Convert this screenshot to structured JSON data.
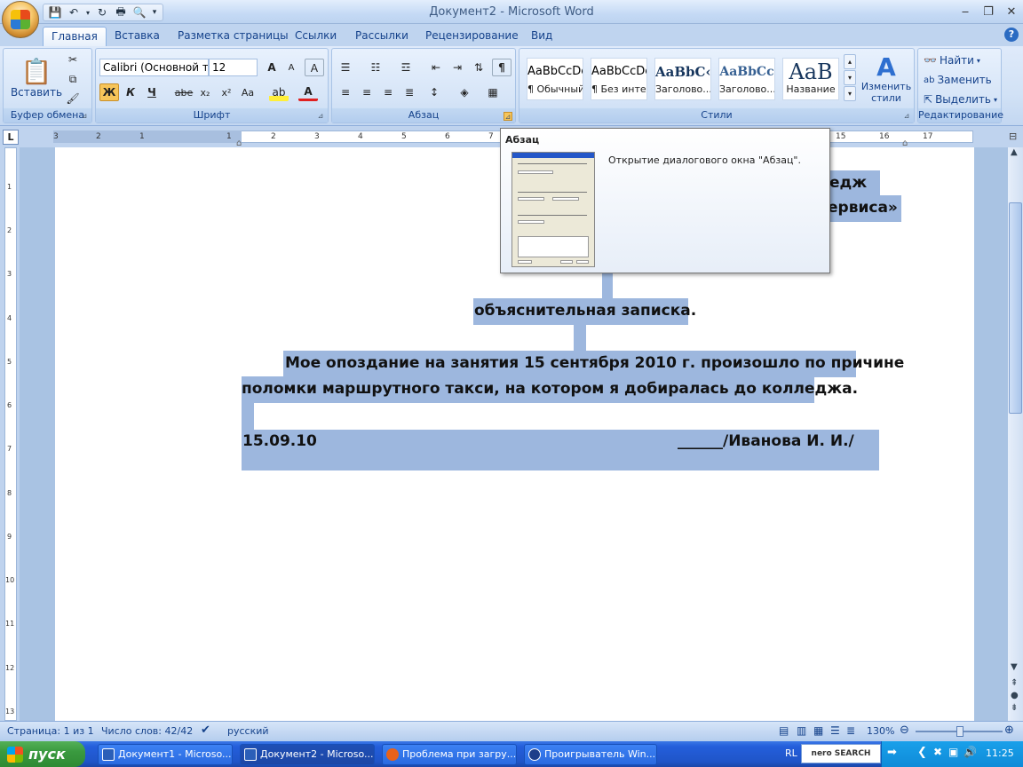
{
  "window": {
    "title": "Документ2 - Microsoft Word",
    "minimize": "‒",
    "restore": "❐",
    "close": "✕"
  },
  "tabs": [
    "Главная",
    "Вставка",
    "Разметка страницы",
    "Ссылки",
    "Рассылки",
    "Рецензирование",
    "Вид"
  ],
  "ribbon": {
    "clipboard": {
      "label": "Буфер обмена",
      "paste": "Вставить"
    },
    "font": {
      "label": "Шрифт",
      "font_name": "Calibri (Основной те",
      "font_size": "12",
      "bold": "Ж",
      "italic": "К",
      "underline": "Ч",
      "strike": "abe",
      "subscript": "x₂",
      "superscript": "x²",
      "change_case": "Аа",
      "grow": "A",
      "shrink": "A",
      "font_color": "A"
    },
    "paragraph": {
      "label": "Абзац",
      "show_marks": "¶"
    },
    "styles": {
      "label": "Стили",
      "items": [
        {
          "sample": "AaBbCcDc",
          "name": "¶ Обычный"
        },
        {
          "sample": "AaBbCcDc",
          "name": "¶ Без инте..."
        },
        {
          "sample": "AaBbC‹",
          "name": "Заголово..."
        },
        {
          "sample": "AaBbCc",
          "name": "Заголово..."
        },
        {
          "sample": "AaB",
          "name": "Название"
        }
      ],
      "change_styles": "Изменить стили"
    },
    "editing": {
      "label": "Редактирование",
      "find": "Найти",
      "replace": "Заменить",
      "select": "Выделить"
    }
  },
  "ruler": {
    "tab_selector": "L",
    "numbers_left": [
      "3",
      "2",
      "1"
    ],
    "numbers_right": [
      "1",
      "2",
      "3",
      "4",
      "5",
      "6",
      "7",
      "15",
      "16",
      "17"
    ],
    "vertical_numbers": [
      "1",
      "1",
      "2",
      "3",
      "4",
      "5",
      "6",
      "7",
      "8",
      "9",
      "10",
      "11",
      "12",
      "13"
    ]
  },
  "document": {
    "fragment1": "едж",
    "fragment2": "ервиса»",
    "heading": "объяснительная записка.",
    "para_line1": "Мое опоздание на занятия 15 сентября 2010 г. произошло по причине",
    "para_line2": "поломки маршрутного такси, на котором я добиралась до колледжа.",
    "date": "15.09.10",
    "signature": "______/Иванова  И. И./"
  },
  "tooltip": {
    "title": "Абзац",
    "description": "Открытие диалогового окна \"Абзац\"."
  },
  "status": {
    "page": "Страница: 1 из 1",
    "words": "Число слов: 42/42",
    "language": "русский",
    "zoom": "130%"
  },
  "taskbar": {
    "start": "пуск",
    "tasks": [
      {
        "label": "Документ1 - Microso...",
        "color": "#2b5fb8"
      },
      {
        "label": "Документ2 - Microso...",
        "color": "#2b5fb8"
      },
      {
        "label": "Проблема при загру...",
        "color": "#e8621a"
      },
      {
        "label": "Проигрыватель Win...",
        "color": "#1e3e8a"
      }
    ],
    "lang": "RL",
    "search": "nero SEARCH",
    "clock": "11:25"
  }
}
